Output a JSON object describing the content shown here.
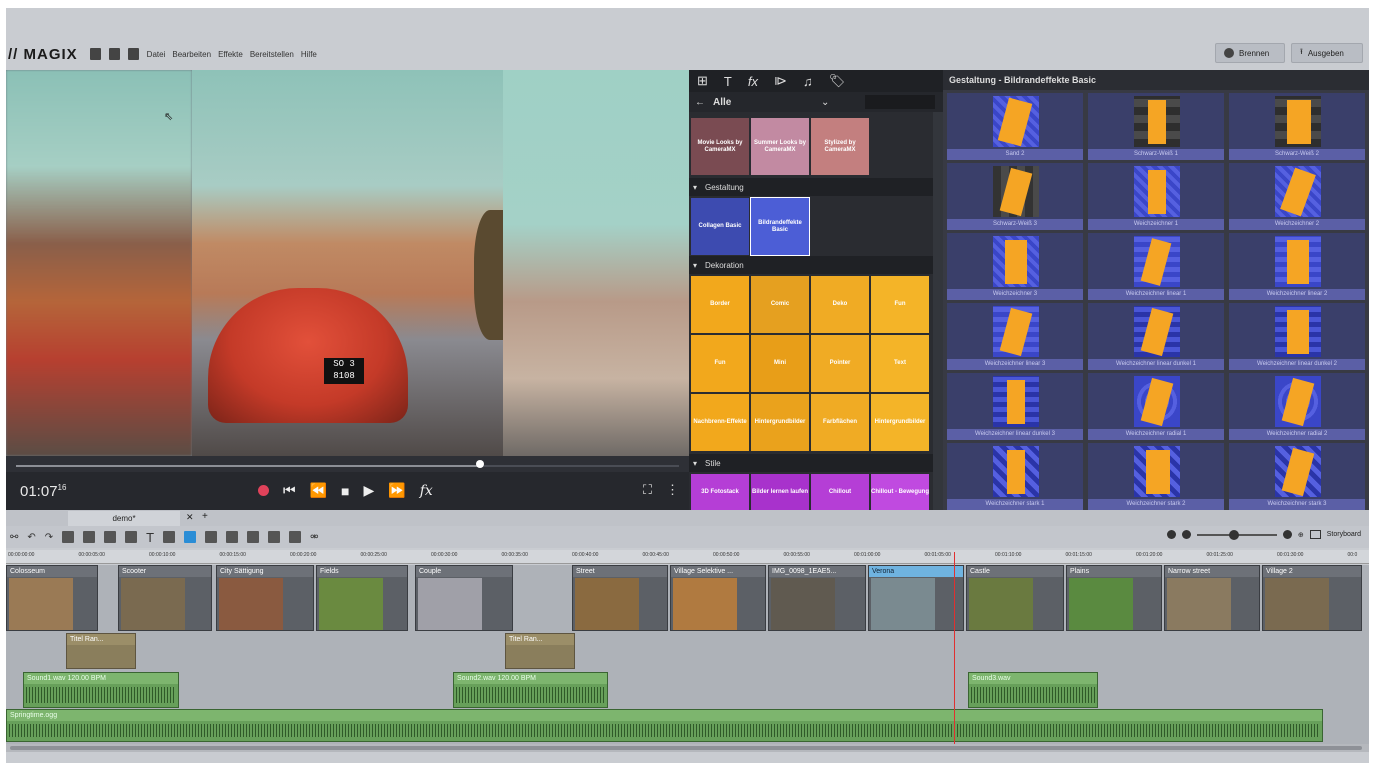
{
  "app": {
    "logo": "// MAGIX",
    "menu": [
      "Datei",
      "Bearbeiten",
      "Effekte",
      "Bereitstellen",
      "Hilfe"
    ],
    "burn_label": "Brennen",
    "output_label": "Ausgeben"
  },
  "preview": {
    "timecode": "01:07",
    "timecode_frames": "16",
    "plate_line1": "SO 3",
    "plate_line2": "8108",
    "scrub_position": 0.7
  },
  "media": {
    "nav_label": "Alle",
    "top_tiles": [
      "Movie Looks by CameraMX",
      "Summer Looks by CameraMX",
      "Stylized by CameraMX"
    ],
    "section_gestaltung": "Gestaltung",
    "gestaltung_tiles": [
      "Collagen Basic",
      "Bildrandeffekte Basic"
    ],
    "section_dekoration": "Dekoration",
    "deko_tiles": [
      "Border",
      "Comic",
      "Deko",
      "Fun",
      "Fun",
      "Mini",
      "Pointer",
      "Text",
      "Nachbrenn-Effekte",
      "Hintergrundbilder",
      "Farbflächen",
      "Hintergrundbilder"
    ],
    "section_stile": "Stile",
    "stile_tiles": [
      "3D Fotostack",
      "Bilder lernen laufen",
      "Chillout",
      "Chillout - Bewegung"
    ]
  },
  "effects": {
    "header": "Gestaltung - Bildrandeffekte Basic",
    "items": [
      "Sand 2",
      "Schwarz-Weiß 1",
      "Schwarz-Weiß 2",
      "Schwarz-Weiß 3",
      "Weichzeichner 1",
      "Weichzeichner 2",
      "Weichzeichner 3",
      "Weichzeichner linear 1",
      "Weichzeichner linear 2",
      "Weichzeichner linear 3",
      "Weichzeichner linear dunkel 1",
      "Weichzeichner linear dunkel 2",
      "Weichzeichner linear dunkel 3",
      "Weichzeichner radial 1",
      "Weichzeichner radial 2",
      "Weichzeichner stark 1",
      "Weichzeichner stark 2",
      "Weichzeichner stark 3"
    ]
  },
  "timeline": {
    "tab": "demo*",
    "storyboard_label": "Storyboard",
    "ruler": [
      "00:00:00:00",
      "00:00:05:00",
      "00:00:10:00",
      "00:00:15:00",
      "00:00:20:00",
      "00:00:25:00",
      "00:00:30:00",
      "00:00:35:00",
      "00:00:40:00",
      "00:00:45:00",
      "00:00:50:00",
      "00:00:55:00",
      "00:01:00:00",
      "00:01:05:00",
      "00:01:10:00",
      "00:01:15:00",
      "00:01:20:00",
      "00:01:25:00",
      "00:01:30:00",
      "00:0"
    ],
    "video_clips": [
      "Colosseum",
      "Scooter",
      "City  Sättigung",
      "Fields",
      "Couple",
      "Street",
      "Village  Selektive ...",
      "IMG_0098_1EAE5...",
      "Verona",
      "Castle",
      "Plains",
      "Narrow street",
      "Village 2"
    ],
    "title_clips": [
      "Titel   Ran...",
      "Titel   Ran..."
    ],
    "audio_clips": [
      "Sound1.wav  120.00 BPM",
      "Sound2.wav  120.00 BPM",
      "Sound3.wav"
    ],
    "music": "Springtime.ogg"
  }
}
